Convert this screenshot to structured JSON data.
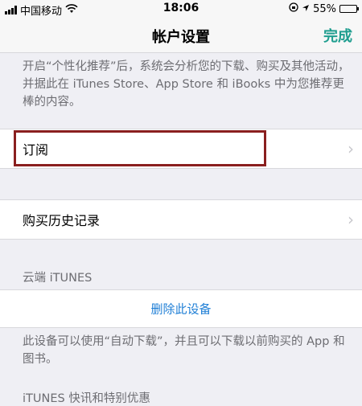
{
  "status_bar": {
    "carrier": "中国移动",
    "time": "18:06",
    "battery_text": "55%",
    "battery_level": 0.55,
    "icons": [
      "signal-icon",
      "wifi-icon",
      "lock-rotation-icon",
      "location-icon",
      "battery-icon"
    ]
  },
  "nav": {
    "title": "帐户设置",
    "done_label": "完成"
  },
  "recommend_footer": "开启“个性化推荐”后，系统会分析您的下载、购买及其他活动，并据此在 iTunes Store、App Store 和 iBooks 中为您推荐更棒的内容。",
  "rows": {
    "subscription": "订阅",
    "purchase_history": "购买历史记录"
  },
  "cloud_section": {
    "header": "云端 iTUNES",
    "remove_device": "删除此设备",
    "footer": "此设备可以使用“自动下载”，并且可以下载以前购买的 App 和图书。"
  },
  "news_section": {
    "header": "iTUNES 快讯和特别优惠"
  },
  "colors": {
    "accent": "#1f9e8f",
    "link": "#1f7fd6",
    "highlight_box": "#8a1f1f"
  }
}
